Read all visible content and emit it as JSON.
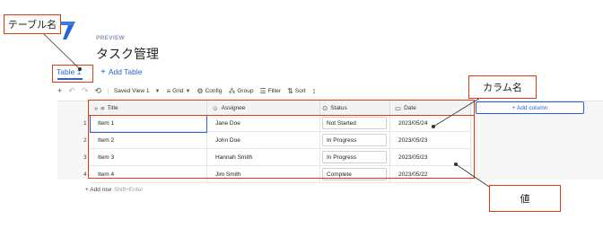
{
  "app": {
    "preview_label": "PREVIEW",
    "title": "タスク管理"
  },
  "tabs": {
    "active_label": "Table 1",
    "add_label": "Add Table",
    "add_icon": "plus-icon"
  },
  "toolbar": {
    "view_label": "Saved View 1",
    "grid_label": "Grid",
    "config_label": "Config",
    "group_label": "Group",
    "filter_label": "Filter",
    "sort_label": "Sort",
    "icons": [
      "plus-icon",
      "undo-icon",
      "redo-icon",
      "history-icon",
      "grid-icon",
      "gear-icon",
      "group-icon",
      "filter-icon",
      "sort-icon",
      "row-height-icon"
    ]
  },
  "grid": {
    "columns": [
      {
        "label": "Title",
        "icon": "text-icon"
      },
      {
        "label": "Assignee",
        "icon": "user-icon"
      },
      {
        "label": "Status",
        "icon": "select-icon"
      },
      {
        "label": "Date",
        "icon": "calendar-icon"
      }
    ],
    "add_column_label": "+ Add column",
    "rows": [
      {
        "num": "1",
        "title": "Item 1",
        "assignee": "Jane Doe",
        "status": "Not Started",
        "date": "2023/05/24"
      },
      {
        "num": "2",
        "title": "Item 2",
        "assignee": "John Doe",
        "status": "In Progress",
        "date": "2023/05/23"
      },
      {
        "num": "3",
        "title": "Item 3",
        "assignee": "Hannah Smith",
        "status": "In Progress",
        "date": "2023/05/23"
      },
      {
        "num": "4",
        "title": "Item 4",
        "assignee": "Jim Smith",
        "status": "Complete",
        "date": "2023/05/22"
      }
    ],
    "add_row_label": "+ Add row",
    "add_row_hint": "Shift+Enter"
  },
  "annotations": {
    "table_name": "テーブル名",
    "column_name": "カラム名",
    "value": "値"
  },
  "colors": {
    "accent": "#2a62d6",
    "annotation_red": "#e03a12"
  }
}
